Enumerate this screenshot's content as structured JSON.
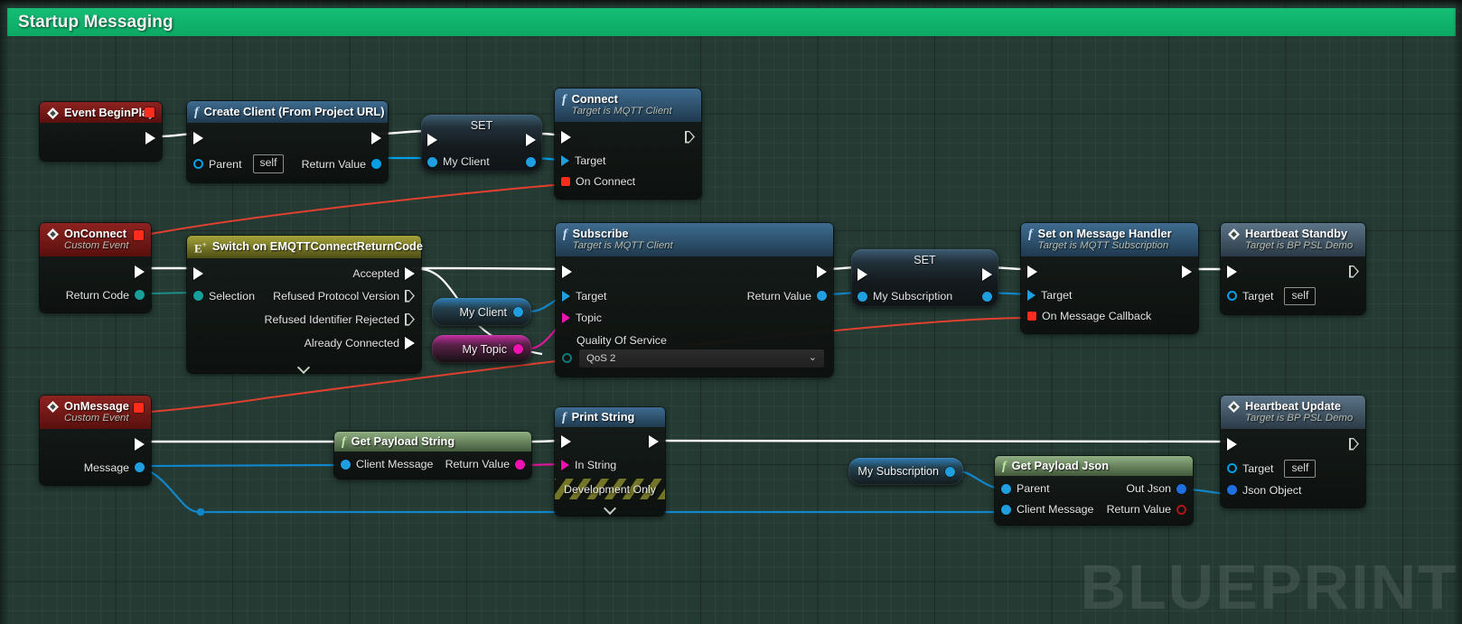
{
  "graph": {
    "comment_title": "Startup Messaging",
    "watermark": "BLUEPRINT",
    "background_color": "#243a33",
    "comment_color": "#0fb36d"
  },
  "pin_colors": {
    "exec": "#ffffff",
    "object": "#00a0e9",
    "string": "#ff00d0",
    "enum": "#0f8080",
    "delegate": "#ff2d1e",
    "self_object": "#00a0e9",
    "struct": "#0088ff",
    "json": "#0a5fd0",
    "bool": "#8b0000"
  },
  "nodes": {
    "event_begin_play": {
      "title": "Event BeginPlay",
      "exec_out": "",
      "header_kind": "event"
    },
    "create_client": {
      "title": "Create Client (From Project URL)",
      "inputs": [
        {
          "label": "Parent",
          "value": "self"
        }
      ],
      "outputs": [
        {
          "label": "Return Value"
        }
      ]
    },
    "set_my_client": {
      "title": "SET",
      "pin_label": "My Client"
    },
    "connect": {
      "title": "Connect",
      "subtitle": "Target is MQTT Client",
      "inputs": [
        {
          "label": "Target"
        },
        {
          "label": "On Connect"
        }
      ]
    },
    "on_connect": {
      "title": "OnConnect",
      "subtitle": "Custom Event",
      "outputs": [
        {
          "label": "Return Code"
        }
      ]
    },
    "switch_return_code": {
      "title": "Switch on EMQTTConnectReturnCode",
      "inputs": [
        {
          "label": "Selection"
        }
      ],
      "outputs": [
        {
          "label": "Accepted"
        },
        {
          "label": "Refused Protocol Version"
        },
        {
          "label": "Refused Identifier Rejected"
        },
        {
          "label": "Already Connected"
        }
      ]
    },
    "get_my_client": {
      "label": "My Client"
    },
    "get_my_topic": {
      "label": "My Topic"
    },
    "subscribe": {
      "title": "Subscribe",
      "subtitle": "Target is MQTT Client",
      "inputs": [
        {
          "label": "Target"
        },
        {
          "label": "Topic"
        }
      ],
      "qos_label": "Quality Of Service",
      "qos_value": "QoS 2",
      "outputs": [
        {
          "label": "Return Value"
        }
      ]
    },
    "set_my_subscription": {
      "title": "SET",
      "pin_label": "My Subscription"
    },
    "set_on_message_handler": {
      "title": "Set on Message Handler",
      "subtitle": "Target is MQTT Subscription",
      "inputs": [
        {
          "label": "Target"
        },
        {
          "label": "On Message Callback"
        }
      ]
    },
    "heartbeat_standby": {
      "title": "Heartbeat Standby",
      "subtitle": "Target is BP PSL Demo",
      "inputs": [
        {
          "label": "Target",
          "value": "self"
        }
      ]
    },
    "on_message": {
      "title": "OnMessage",
      "subtitle": "Custom Event",
      "outputs": [
        {
          "label": "Message"
        }
      ]
    },
    "get_payload_string": {
      "title": "Get Payload String",
      "inputs": [
        {
          "label": "Client Message"
        }
      ],
      "outputs": [
        {
          "label": "Return Value"
        }
      ]
    },
    "print_string": {
      "title": "Print String",
      "inputs": [
        {
          "label": "In String"
        }
      ],
      "footer": "Development Only"
    },
    "get_my_subscription": {
      "label": "My Subscription"
    },
    "get_payload_json": {
      "title": "Get Payload Json",
      "inputs": [
        {
          "label": "Parent"
        },
        {
          "label": "Client Message"
        }
      ],
      "outputs": [
        {
          "label": "Out Json"
        },
        {
          "label": "Return Value"
        }
      ]
    },
    "heartbeat_update": {
      "title": "Heartbeat Update",
      "subtitle": "Target is BP PSL Demo",
      "inputs": [
        {
          "label": "Target",
          "value": "self"
        },
        {
          "label": "Json Object"
        }
      ]
    }
  },
  "icons": {
    "function": "f",
    "pure_function": "f",
    "switch": "E",
    "event_diamond": "event-diamond-icon",
    "dropdown_chevron": "⌄",
    "expand_chevron": "⌄"
  }
}
